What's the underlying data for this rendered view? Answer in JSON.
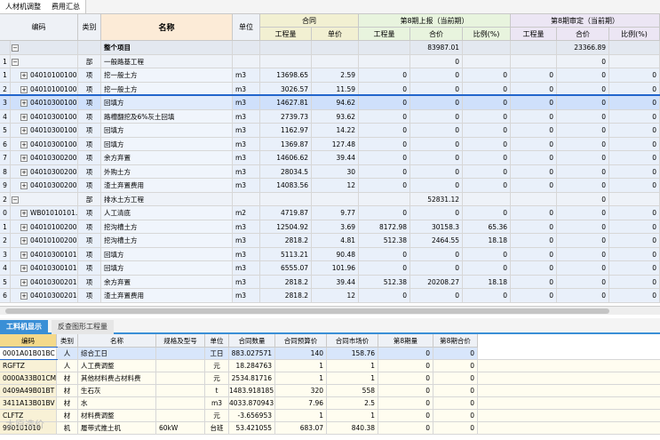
{
  "top_tabs": [
    "人材机调整",
    "费用汇总"
  ],
  "headers": {
    "code": "编码",
    "type": "类别",
    "name": "名称",
    "unit": "单位",
    "contract": "合同",
    "qty": "工程量",
    "price": "单价",
    "period_report": "第8期上报（当前期）",
    "period_approve": "第8期审定（当前期）",
    "amount": "合价",
    "ratio": "比例(%)"
  },
  "rows": [
    {
      "idx": "",
      "code": "",
      "type": "",
      "name": "整个项目",
      "unit": "",
      "qty": "",
      "price": "",
      "q1": "",
      "a1": "83987.01",
      "r1": "",
      "q2": "",
      "a2": "23366.89",
      "r2": "",
      "lvl": 0,
      "hl": false
    },
    {
      "idx": "1",
      "code": "",
      "type": "部",
      "name": "一般路基工程",
      "unit": "",
      "qty": "",
      "price": "",
      "q1": "",
      "a1": "0",
      "r1": "",
      "q2": "",
      "a2": "0",
      "r2": "",
      "lvl": 1,
      "hl": false
    },
    {
      "idx": "1",
      "code": "040101001001",
      "type": "项",
      "name": "挖一般土方",
      "unit": "m3",
      "qty": "13698.65",
      "price": "2.59",
      "q1": "0",
      "a1": "0",
      "r1": "0",
      "q2": "0",
      "a2": "0",
      "r2": "0",
      "lvl": 2,
      "hl": false
    },
    {
      "idx": "2",
      "code": "040101001002",
      "type": "项",
      "name": "挖一般土方",
      "unit": "m3",
      "qty": "3026.57",
      "price": "11.59",
      "q1": "0",
      "a1": "0",
      "r1": "0",
      "q2": "0",
      "a2": "0",
      "r2": "0",
      "lvl": 2,
      "hl": false
    },
    {
      "idx": "3",
      "code": "040103001001",
      "type": "项",
      "name": "回填方",
      "unit": "m3",
      "qty": "14627.81",
      "price": "94.62",
      "q1": "0",
      "a1": "0",
      "r1": "0",
      "q2": "0",
      "a2": "0",
      "r2": "0",
      "lvl": 2,
      "hl": true
    },
    {
      "idx": "4",
      "code": "040103001002",
      "type": "项",
      "name": "路槽翻挖及6%灰土回填",
      "unit": "m3",
      "qty": "2739.73",
      "price": "93.62",
      "q1": "0",
      "a1": "0",
      "r1": "0",
      "q2": "0",
      "a2": "0",
      "r2": "0",
      "lvl": 2,
      "hl": false
    },
    {
      "idx": "5",
      "code": "040103001003",
      "type": "项",
      "name": "回填方",
      "unit": "m3",
      "qty": "1162.97",
      "price": "14.22",
      "q1": "0",
      "a1": "0",
      "r1": "0",
      "q2": "0",
      "a2": "0",
      "r2": "0",
      "lvl": 2,
      "hl": false
    },
    {
      "idx": "6",
      "code": "040103001004",
      "type": "项",
      "name": "回填方",
      "unit": "m3",
      "qty": "1369.87",
      "price": "127.48",
      "q1": "0",
      "a1": "0",
      "r1": "0",
      "q2": "0",
      "a2": "0",
      "r2": "0",
      "lvl": 2,
      "hl": false
    },
    {
      "idx": "7",
      "code": "040103002001",
      "type": "项",
      "name": "余方弃置",
      "unit": "m3",
      "qty": "14606.62",
      "price": "39.44",
      "q1": "0",
      "a1": "0",
      "r1": "0",
      "q2": "0",
      "a2": "0",
      "r2": "0",
      "lvl": 2,
      "hl": false
    },
    {
      "idx": "8",
      "code": "040103002002",
      "type": "项",
      "name": "外购土方",
      "unit": "m3",
      "qty": "28034.5",
      "price": "30",
      "q1": "0",
      "a1": "0",
      "r1": "0",
      "q2": "0",
      "a2": "0",
      "r2": "0",
      "lvl": 2,
      "hl": false
    },
    {
      "idx": "9",
      "code": "040103002006",
      "type": "项",
      "name": "渣土弃置费用",
      "unit": "m3",
      "qty": "14083.56",
      "price": "12",
      "q1": "0",
      "a1": "0",
      "r1": "0",
      "q2": "0",
      "a2": "0",
      "r2": "0",
      "lvl": 2,
      "hl": false
    },
    {
      "idx": "2",
      "code": "",
      "type": "部",
      "name": "排水土方工程",
      "unit": "",
      "qty": "",
      "price": "",
      "q1": "",
      "a1": "52831.12",
      "r1": "",
      "q2": "",
      "a2": "0",
      "r2": "",
      "lvl": 1,
      "hl": false
    },
    {
      "idx": "0",
      "code": "WB01010101…",
      "type": "项",
      "name": "人工清底",
      "unit": "m2",
      "qty": "4719.87",
      "price": "9.77",
      "q1": "0",
      "a1": "0",
      "r1": "0",
      "q2": "0",
      "a2": "0",
      "r2": "0",
      "lvl": 2,
      "hl": false
    },
    {
      "idx": "1",
      "code": "040101002001",
      "type": "项",
      "name": "挖沟槽土方",
      "unit": "m3",
      "qty": "12504.92",
      "price": "3.69",
      "q1": "8172.98",
      "a1": "30158.3",
      "r1": "65.36",
      "q2": "0",
      "a2": "0",
      "r2": "0",
      "lvl": 2,
      "hl": false
    },
    {
      "idx": "2",
      "code": "040101002002",
      "type": "项",
      "name": "挖沟槽土方",
      "unit": "m3",
      "qty": "2818.2",
      "price": "4.81",
      "q1": "512.38",
      "a1": "2464.55",
      "r1": "18.18",
      "q2": "0",
      "a2": "0",
      "r2": "0",
      "lvl": 2,
      "hl": false
    },
    {
      "idx": "3",
      "code": "040103001011",
      "type": "项",
      "name": "回填方",
      "unit": "m3",
      "qty": "5113.21",
      "price": "90.48",
      "q1": "0",
      "a1": "0",
      "r1": "0",
      "q2": "0",
      "a2": "0",
      "r2": "0",
      "lvl": 2,
      "hl": false
    },
    {
      "idx": "4",
      "code": "040103001012",
      "type": "项",
      "name": "回填方",
      "unit": "m3",
      "qty": "6555.07",
      "price": "101.96",
      "q1": "0",
      "a1": "0",
      "r1": "0",
      "q2": "0",
      "a2": "0",
      "r2": "0",
      "lvl": 2,
      "hl": false
    },
    {
      "idx": "5",
      "code": "040103002012",
      "type": "项",
      "name": "余方弃置",
      "unit": "m3",
      "qty": "2818.2",
      "price": "39.44",
      "q1": "512.38",
      "a1": "20208.27",
      "r1": "18.18",
      "q2": "0",
      "a2": "0",
      "r2": "0",
      "lvl": 2,
      "hl": false
    },
    {
      "idx": "6",
      "code": "040103002014",
      "type": "项",
      "name": "渣土弃置费用",
      "unit": "m3",
      "qty": "2818.2",
      "price": "12",
      "q1": "0",
      "a1": "0",
      "r1": "0",
      "q2": "0",
      "a2": "0",
      "r2": "0",
      "lvl": 2,
      "hl": false
    }
  ],
  "bottom_tabs": [
    "工料机显示",
    "反查图形工程量"
  ],
  "bottom_headers": [
    "编码",
    "类别",
    "名称",
    "规格及型号",
    "单位",
    "合同数量",
    "合同预算价",
    "合同市场价",
    "第8期量",
    "第8期合价"
  ],
  "bottom_rows": [
    [
      "0001A01B01BC",
      "人",
      "综合工日",
      "",
      "工日",
      "883.027571",
      "140",
      "158.76",
      "0",
      "0"
    ],
    [
      "RGFTZ",
      "人",
      "人工费调整",
      "",
      "元",
      "18.284763",
      "1",
      "1",
      "0",
      "0"
    ],
    [
      "0000A33B01CM",
      "材",
      "其他材料费占材料费",
      "",
      "元",
      "2534.81716",
      "1",
      "1",
      "0",
      "0"
    ],
    [
      "0409A49B01BT",
      "材",
      "生石灰",
      "",
      "t",
      "1483.918185",
      "320",
      "558",
      "0",
      "0"
    ],
    [
      "3411A13B01BV",
      "材",
      "水",
      "",
      "m3",
      "4033.870943",
      "7.96",
      "2.5",
      "0",
      "0"
    ],
    [
      "CLFTZ",
      "材",
      "材料费调整",
      "",
      "元",
      "-3.656953",
      "1",
      "1",
      "0",
      "0"
    ],
    [
      "990101010",
      "机",
      "履带式推土机",
      "60kW",
      "台班",
      "53.421055",
      "683.07",
      "840.38",
      "0",
      "0"
    ]
  ],
  "watermark": "太原造价"
}
